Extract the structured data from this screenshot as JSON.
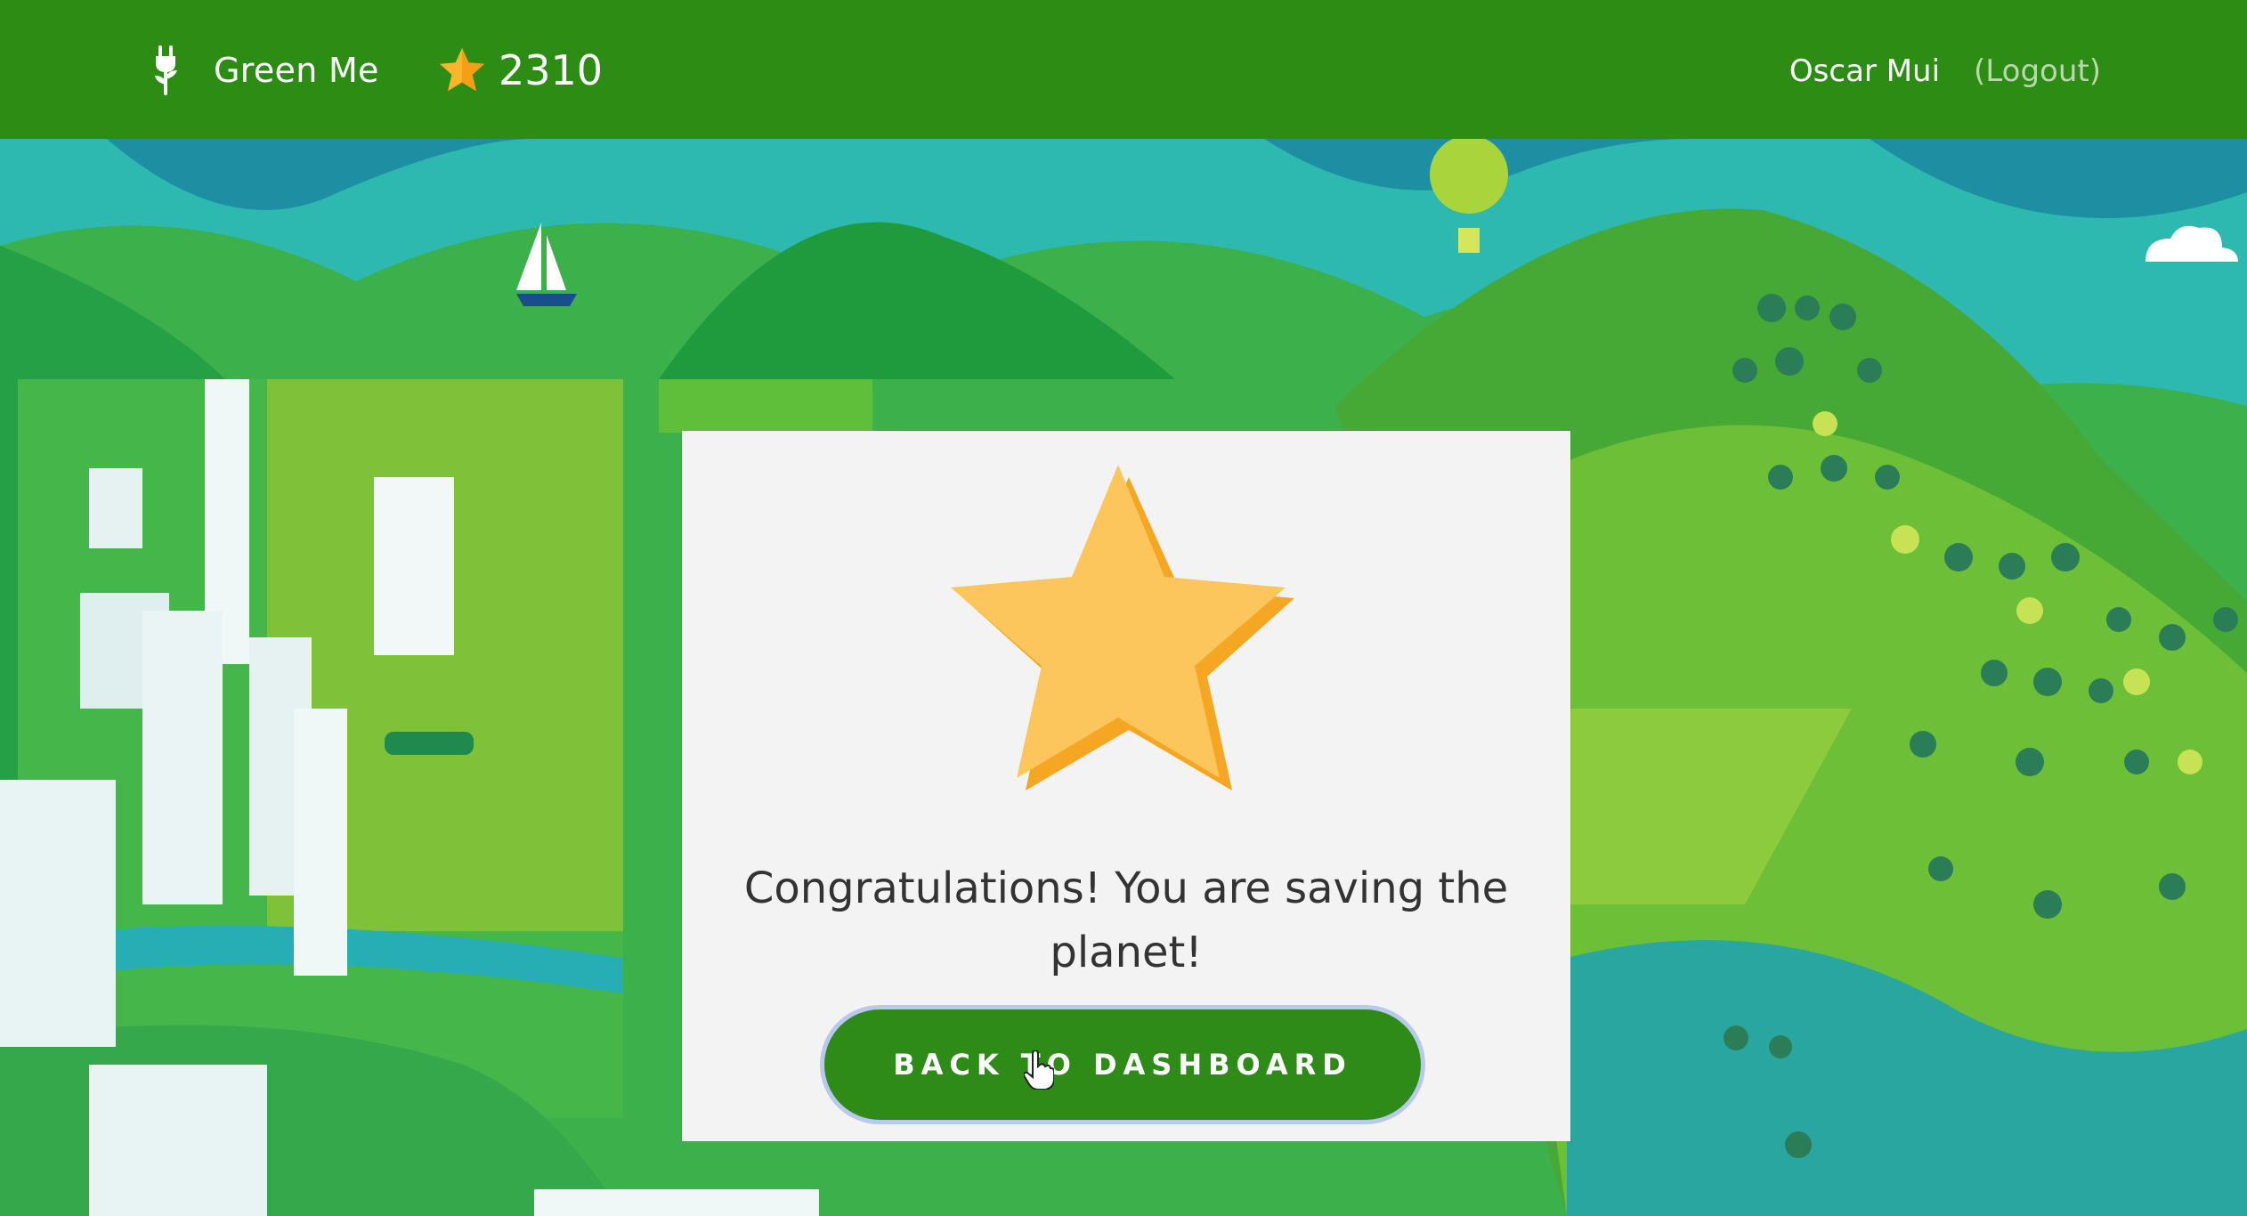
{
  "app": {
    "name": "Green Me",
    "points": "2310"
  },
  "user": {
    "name": "Oscar Mui",
    "logout_label": "(Logout)"
  },
  "modal": {
    "message": "Congratulations! You are saving the planet!",
    "button_label": "BACK TO DASHBOARD"
  },
  "icons": {
    "brand": "plug-leaf-icon",
    "points": "star-icon",
    "modal": "large-star-icon"
  },
  "colors": {
    "header": "#2c8c14",
    "button": "#2e8b17",
    "star": "#fcc65c",
    "star_shadow": "#f5a623"
  }
}
